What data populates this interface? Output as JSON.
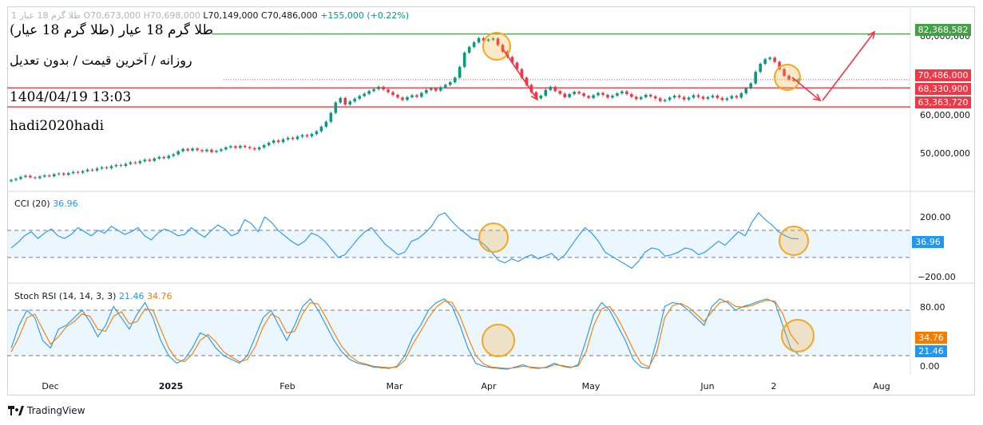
{
  "header": {
    "symbol_line": {
      "symbol": "طلا گرم 18 عیار 1",
      "open": "O70,673,000",
      "high": "H70,698,000",
      "low": "L70,149,000",
      "close": "C70,486,000",
      "change": "+155,000 (+0.22%)"
    },
    "title": "طلا گرم 18 عیار (طلا گرم 18 عیار)",
    "subtitle": "روزانه / آخرین قیمت / بدون تعدیل",
    "datetime": "1404/04/19 13:03",
    "author": "hadi2020hadi"
  },
  "price_axis": {
    "ticks": [
      "80,000,000",
      "60,000,000",
      "50,000,000"
    ],
    "tags": [
      {
        "label": "82,368,582",
        "color": "#43a047"
      },
      {
        "label": "70,486,000",
        "color": "#f23645"
      },
      {
        "label": "68,330,900",
        "color": "#f23645"
      },
      {
        "label": "63,363,720",
        "color": "#f23645"
      }
    ]
  },
  "cci": {
    "name": "CCI (20)",
    "value": "36.96",
    "ticks": [
      "200.00",
      "−200.00"
    ],
    "tag": "36.96"
  },
  "stoch": {
    "name": "Stoch RSI (14, 14, 3, 3)",
    "k_value": "21.46",
    "d_value": "34.76",
    "ticks": [
      "80.00",
      "0.00"
    ],
    "tags": [
      "34.76",
      "21.46"
    ]
  },
  "time_axis": [
    "Dec",
    "2025",
    "Feb",
    "Mar",
    "Apr",
    "May",
    "Jun",
    "2",
    "Aug"
  ],
  "branding": {
    "logo_text": "TradingView"
  },
  "colors": {
    "up": "#089981",
    "down": "#f23645",
    "resistance": "#43a047",
    "support": "#f23645",
    "cci_line": "#2196f3",
    "stoch_k": "#2196f3",
    "stoch_d": "#f57c00",
    "band_fill": "#e3f2fd",
    "highlight": "#f5a623"
  },
  "chart_data": [
    {
      "type": "candlestick",
      "levels": [
        82368582,
        68330900,
        63363720
      ],
      "last_close": 70486000,
      "ylim": [
        43000000,
        85000000
      ],
      "close": [
        44.3,
        44.6,
        45.1,
        45.4,
        45.0,
        44.8,
        45.2,
        45.5,
        45.3,
        45.8,
        46.0,
        45.7,
        46.1,
        46.4,
        46.2,
        46.6,
        47.0,
        46.8,
        47.3,
        47.6,
        47.4,
        47.9,
        48.2,
        48.0,
        48.5,
        48.9,
        48.7,
        49.2,
        49.6,
        49.3,
        49.9,
        50.3,
        50.0,
        50.6,
        51.0,
        51.8,
        52.4,
        52.0,
        52.5,
        52.1,
        51.8,
        52.2,
        51.6,
        51.9,
        52.3,
        52.8,
        53.1,
        52.7,
        53.2,
        52.9,
        52.6,
        52.3,
        52.8,
        53.4,
        54.0,
        54.6,
        54.2,
        54.9,
        55.3,
        55.0,
        55.6,
        56.0,
        55.7,
        56.3,
        57.0,
        58.2,
        59.5,
        61.8,
        64.5,
        65.7,
        64.0,
        64.8,
        65.5,
        66.2,
        66.8,
        67.5,
        68.0,
        68.6,
        67.9,
        67.2,
        66.5,
        65.8,
        65.2,
        65.9,
        66.4,
        66.0,
        67.0,
        67.8,
        68.2,
        67.6,
        68.5,
        69.1,
        69.8,
        71.0,
        73.8,
        77.5,
        79.0,
        80.2,
        81.3,
        80.6,
        80.9,
        81.2,
        79.5,
        77.8,
        76.4,
        74.9,
        73.2,
        71.0,
        69.1,
        67.2,
        65.6,
        66.3,
        67.8,
        68.6,
        67.5,
        66.8,
        65.9,
        66.7,
        67.3,
        66.9,
        66.2,
        65.7,
        66.4,
        67.0,
        66.5,
        65.8,
        66.3,
        66.9,
        67.4,
        66.7,
        66.0,
        65.4,
        65.9,
        66.5,
        66.1,
        65.6,
        64.9,
        65.2,
        65.8,
        66.3,
        65.9,
        65.3,
        65.8,
        66.4,
        66.0,
        65.5,
        65.9,
        66.3,
        65.7,
        65.2,
        65.6,
        66.2,
        65.8,
        66.9,
        68.2,
        69.5,
        72.5,
        74.6,
        75.8,
        76.2,
        75.1,
        73.2,
        71.5,
        70.5,
        70.2,
        70.486
      ]
    },
    {
      "type": "line",
      "name": "CCI (20)",
      "ylim": [
        -260,
        300
      ],
      "bands": [
        100,
        -100
      ],
      "last": 36.96,
      "values": [
        -30,
        10,
        60,
        90,
        40,
        80,
        110,
        60,
        40,
        70,
        120,
        90,
        60,
        100,
        80,
        130,
        100,
        70,
        90,
        120,
        60,
        30,
        80,
        110,
        90,
        60,
        70,
        120,
        80,
        50,
        100,
        140,
        110,
        60,
        80,
        180,
        150,
        90,
        200,
        160,
        100,
        60,
        20,
        -10,
        20,
        80,
        60,
        20,
        -40,
        -100,
        -80,
        -20,
        40,
        90,
        120,
        60,
        0,
        -40,
        -80,
        -60,
        20,
        40,
        80,
        130,
        210,
        230,
        170,
        120,
        80,
        40,
        30,
        -10,
        -60,
        -120,
        -140,
        -110,
        -130,
        -100,
        -80,
        -110,
        -90,
        -70,
        -120,
        -80,
        -10,
        60,
        120,
        80,
        20,
        -60,
        -90,
        -120,
        -150,
        -180,
        -130,
        -60,
        -30,
        -40,
        -90,
        -80,
        -60,
        -30,
        -40,
        -80,
        -60,
        -20,
        20,
        -10,
        40,
        90,
        60,
        160,
        230,
        180,
        140,
        90,
        60,
        40,
        36.96
      ]
    },
    {
      "type": "line",
      "name": "Stoch RSI (14, 14, 3, 3)",
      "ylim": [
        0,
        100
      ],
      "bands": [
        80,
        20
      ],
      "series": [
        {
          "name": "%K",
          "last": 21.46,
          "values": [
            30,
            60,
            80,
            70,
            40,
            30,
            55,
            60,
            70,
            80,
            65,
            45,
            60,
            85,
            70,
            55,
            75,
            90,
            70,
            40,
            20,
            10,
            15,
            30,
            50,
            45,
            30,
            20,
            15,
            10,
            20,
            45,
            70,
            80,
            60,
            40,
            60,
            85,
            95,
            80,
            60,
            40,
            25,
            15,
            10,
            8,
            5,
            4,
            3,
            6,
            20,
            45,
            60,
            80,
            90,
            95,
            85,
            60,
            30,
            10,
            6,
            4,
            3,
            2,
            5,
            8,
            4,
            3,
            5,
            10,
            6,
            4,
            8,
            40,
            75,
            90,
            80,
            60,
            40,
            15,
            5,
            3,
            40,
            85,
            90,
            88,
            80,
            70,
            60,
            85,
            95,
            90,
            80,
            85,
            88,
            92,
            95,
            90,
            60,
            30,
            21.46
          ]
        },
        {
          "name": "%D",
          "last": 34.76,
          "values": [
            25,
            45,
            70,
            75,
            55,
            35,
            45,
            58,
            65,
            75,
            72,
            55,
            52,
            72,
            78,
            62,
            65,
            82,
            80,
            55,
            30,
            15,
            12,
            22,
            40,
            48,
            38,
            25,
            18,
            12,
            15,
            32,
            58,
            75,
            70,
            50,
            52,
            75,
            90,
            88,
            70,
            50,
            32,
            20,
            12,
            9,
            6,
            5,
            4,
            5,
            14,
            35,
            52,
            70,
            84,
            92,
            90,
            72,
            45,
            20,
            9,
            5,
            4,
            3,
            4,
            6,
            5,
            4,
            4,
            8,
            7,
            5,
            6,
            25,
            60,
            82,
            85,
            70,
            50,
            28,
            10,
            5,
            25,
            70,
            86,
            89,
            84,
            75,
            65,
            78,
            90,
            92,
            85,
            84,
            86,
            90,
            93,
            92,
            75,
            48,
            34.76
          ]
        }
      ]
    }
  ]
}
